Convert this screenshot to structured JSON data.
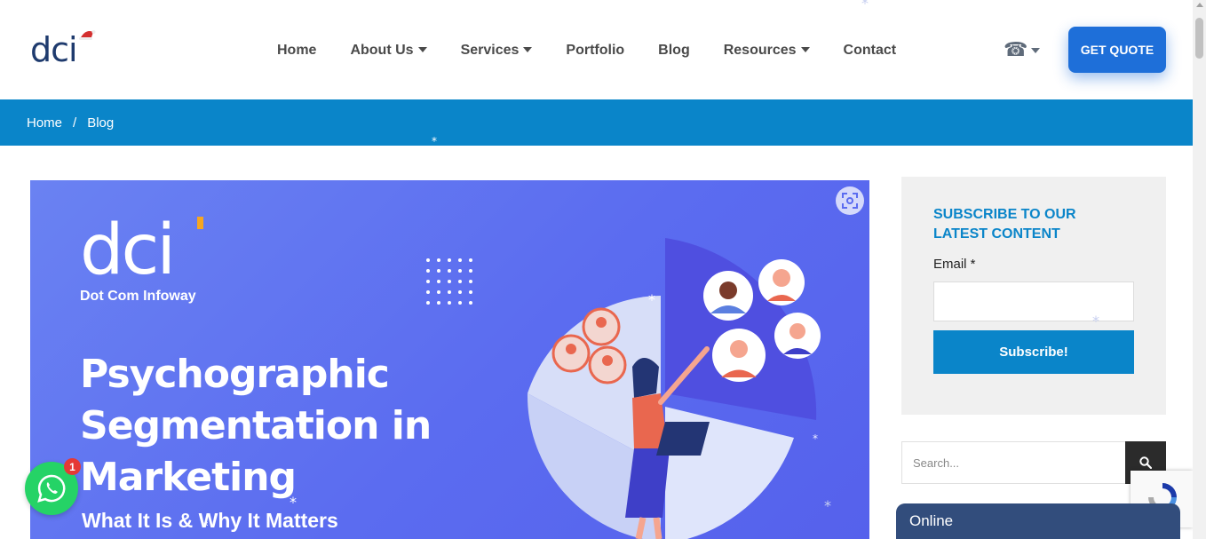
{
  "brand": {
    "logo_text": "dci"
  },
  "nav": {
    "items": [
      {
        "label": "Home",
        "dropdown": false
      },
      {
        "label": "About Us",
        "dropdown": true
      },
      {
        "label": "Services",
        "dropdown": true
      },
      {
        "label": "Portfolio",
        "dropdown": false
      },
      {
        "label": "Blog",
        "dropdown": false
      },
      {
        "label": "Resources",
        "dropdown": true
      },
      {
        "label": "Contact",
        "dropdown": false
      }
    ],
    "phone_icon": "☎",
    "quote_label": "GET QUOTE"
  },
  "breadcrumb": {
    "home": "Home",
    "separator": "/",
    "current": "Blog"
  },
  "hero": {
    "logo_text": "dci",
    "logo_subtitle": "Dot Com Infoway",
    "title_lines": [
      "Psychographic",
      "Segmentation in",
      "Marketing"
    ],
    "subtitle": "What It Is & Why It Matters"
  },
  "subscribe": {
    "title": "SUBSCRIBE TO OUR LATEST CONTENT",
    "email_label": "Email *",
    "button_label": "Subscribe!"
  },
  "search": {
    "placeholder": "Search..."
  },
  "chat": {
    "label": "Online"
  },
  "whatsapp": {
    "badge": "1"
  },
  "colors": {
    "primary": "#0a85c9",
    "quote": "#1e6fd9",
    "hero": "#5b6cf0",
    "chat": "#324d7c",
    "whatsapp": "#25d366"
  },
  "icons": {
    "phone": "phone-icon",
    "search": "search-icon",
    "expand": "expand-icon",
    "whatsapp": "whatsapp-icon"
  }
}
